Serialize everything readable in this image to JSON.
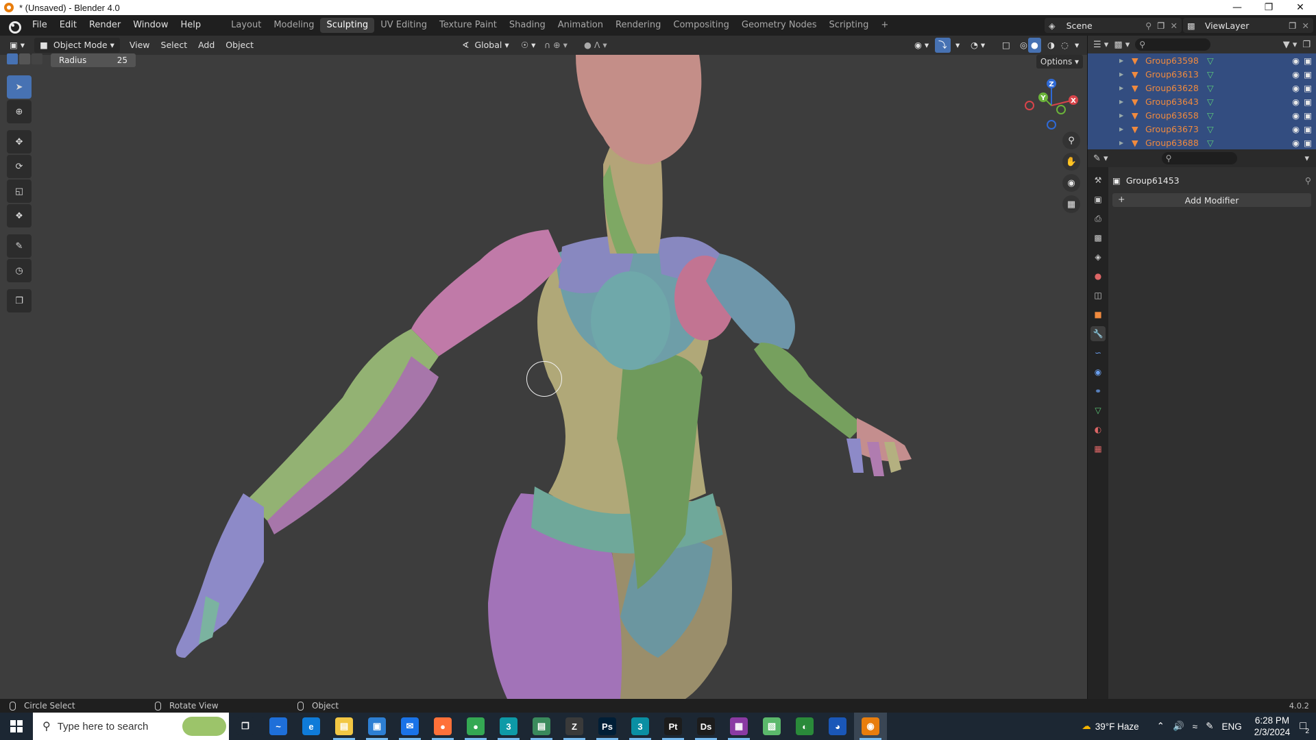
{
  "window": {
    "title": "* (Unsaved) - Blender 4.0",
    "minimize": "—",
    "restore": "❐",
    "close": "✕"
  },
  "menu": [
    "File",
    "Edit",
    "Render",
    "Window",
    "Help"
  ],
  "workspaces": [
    "Layout",
    "Modeling",
    "Sculpting",
    "UV Editing",
    "Texture Paint",
    "Shading",
    "Animation",
    "Rendering",
    "Compositing",
    "Geometry Nodes",
    "Scripting"
  ],
  "active_workspace": "Sculpting",
  "add_workspace": "+",
  "scene": {
    "name": "Scene",
    "view_layer": "ViewLayer"
  },
  "viewport_header": {
    "mode": "Object Mode",
    "view": "View",
    "select": "Select",
    "add": "Add",
    "object": "Object",
    "transform_orientation": "Global"
  },
  "tool_settings": {
    "radius_label": "Radius",
    "radius_value": "25",
    "options": "Options"
  },
  "gizmo": {
    "z": "Z",
    "y": "Y",
    "x": "X"
  },
  "outliner": {
    "rows": [
      "Group63598",
      "Group63613",
      "Group63628",
      "Group63643",
      "Group63658",
      "Group63673",
      "Group63688"
    ]
  },
  "properties": {
    "object_name": "Group61453",
    "add_modifier": "Add Modifier",
    "add_plus": "+"
  },
  "statusbar": {
    "left": "Circle Select",
    "middle": "Rotate View",
    "right": "Object",
    "version": "4.0.2"
  },
  "taskbar": {
    "search_placeholder": "Type here to search",
    "weather": "39°F  Haze",
    "language": "ENG",
    "time": "6:28 PM",
    "date": "2/3/2024",
    "notifications": "2",
    "apps": [
      "Task View",
      "App",
      "Edge",
      "File Explorer",
      "Store",
      "Mail",
      "Firefox",
      "Chrome",
      "3",
      "Files",
      "ZBrush",
      "Ps",
      "3ds Max",
      "Pt",
      "Ds",
      "App",
      "App",
      "App",
      "App",
      "Blender"
    ],
    "app_glyphs": [
      "❐",
      "~",
      "e",
      "▤",
      "▣",
      "✉",
      "●",
      "●",
      "3",
      "▤",
      "Z",
      "Ps",
      "3",
      "Pt",
      "Ds",
      "▦",
      "▧",
      "◐",
      "◕",
      "◉"
    ],
    "app_colors": [
      "#1c2733",
      "#1e6fd9",
      "#0f7bd8",
      "#f2c744",
      "#2d7fd3",
      "#1a73e8",
      "#ff7139",
      "#34a853",
      "#0e9aa7",
      "#3a8a5c",
      "#3a3a3a",
      "#001e36",
      "#0a8fa3",
      "#1c1c1c",
      "#1c1c1c",
      "#8a3aa3",
      "#5bb86b",
      "#2a8a3a",
      "#1a57b8",
      "#e87d0d"
    ]
  },
  "colors": {
    "accent": "#4772b3",
    "outliner_selected": "#334d80",
    "object_text": "#f08a3e"
  }
}
